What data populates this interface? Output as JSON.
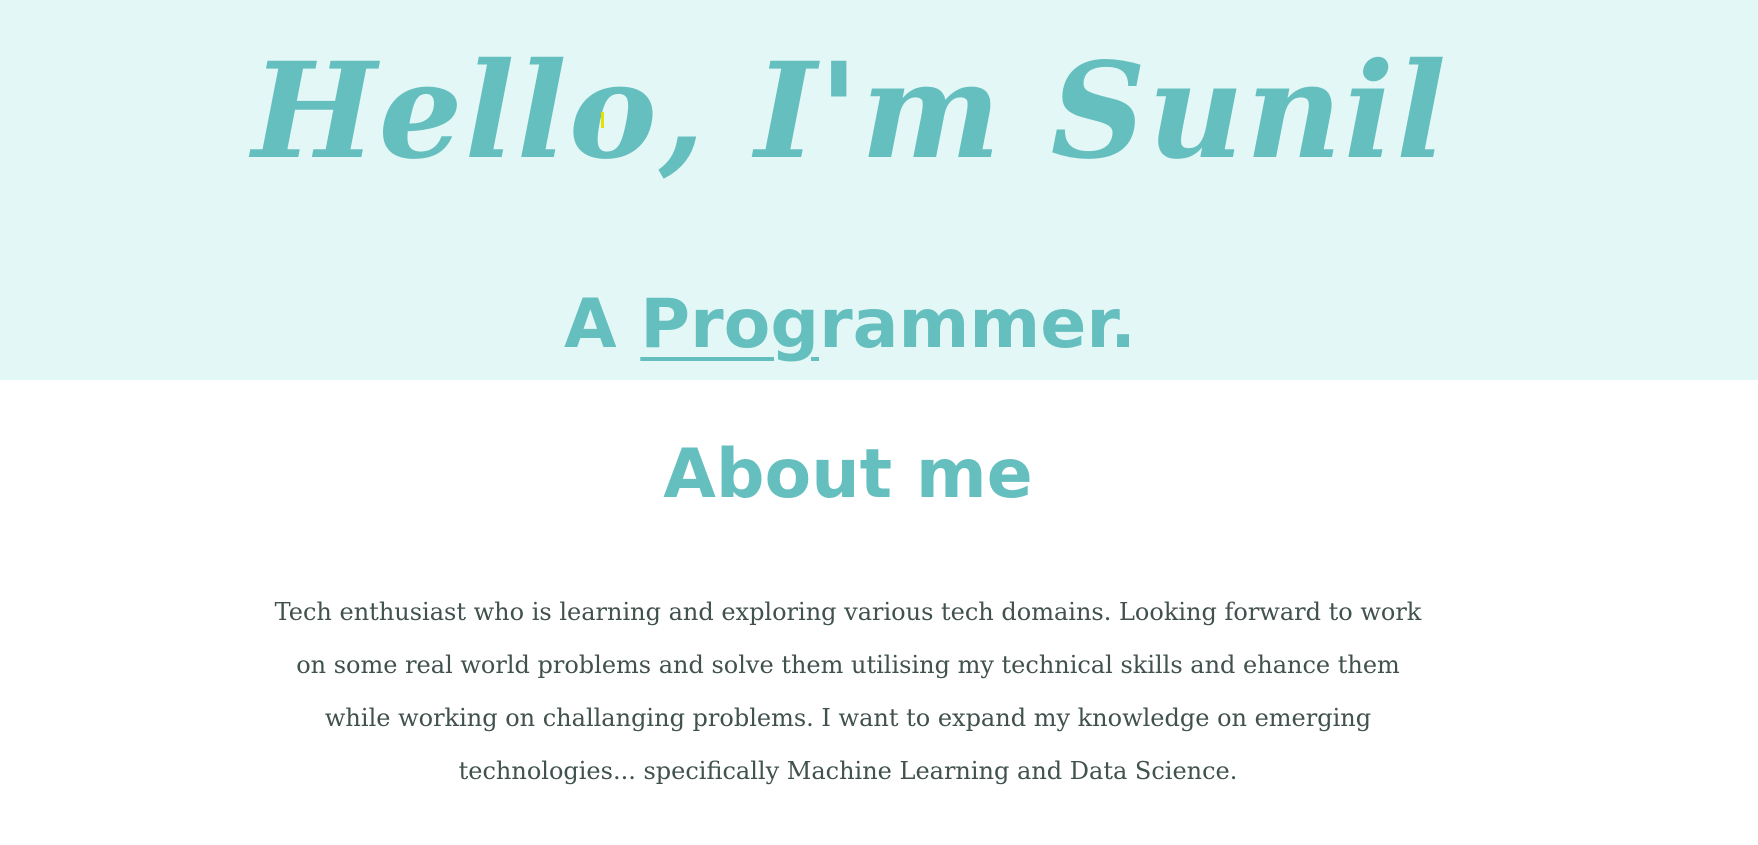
{
  "hero": {
    "greeting": "Hello, I'm Sunil",
    "subtitle_prefix": "A ",
    "subtitle_typed": "Prog",
    "subtitle_rest": "rammer."
  },
  "about": {
    "heading": "About me",
    "body": "Tech enthusiast who is learning and exploring various tech domains. Looking forward to work on some real world problems and solve them utilising my technical skills and ehance them while working on challanging problems. I want to expand my knowledge on emerging technologies... specifically Machine Learning and Data Science."
  },
  "colors": {
    "hero_background": "#e3f8f6",
    "accent": "#66bfbf",
    "body_text": "#40514e",
    "cursor": "#e8e000"
  }
}
